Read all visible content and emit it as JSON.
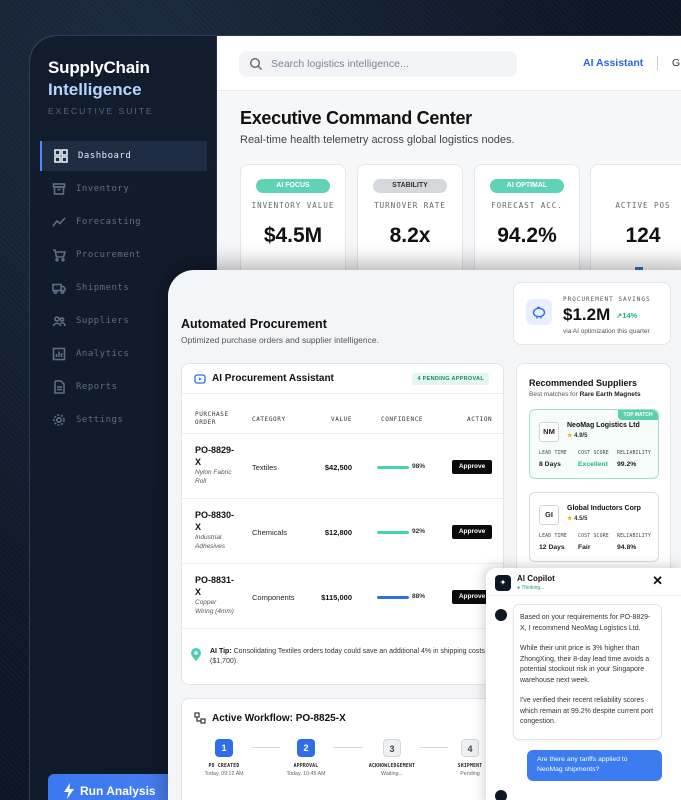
{
  "brand": {
    "line1": "SupplyChain",
    "line2": "Intelligence",
    "suite": "EXECUTIVE SUITE"
  },
  "sidebar": {
    "items": [
      {
        "label": "Dashboard",
        "icon": "grid-icon"
      },
      {
        "label": "Inventory",
        "icon": "box-icon"
      },
      {
        "label": "Forecasting",
        "icon": "trend-icon"
      },
      {
        "label": "Procurement",
        "icon": "cart-icon"
      },
      {
        "label": "Shipments",
        "icon": "truck-icon"
      },
      {
        "label": "Suppliers",
        "icon": "users-icon"
      },
      {
        "label": "Analytics",
        "icon": "chart-icon"
      },
      {
        "label": "Reports",
        "icon": "file-icon"
      },
      {
        "label": "Settings",
        "icon": "gear-icon"
      }
    ],
    "run_label": "Run Analysis"
  },
  "topbar": {
    "search_placeholder": "Search logistics intelligence...",
    "ai_assistant": "AI Assistant",
    "extra": "G"
  },
  "command": {
    "title": "Executive Command Center",
    "subtitle": "Real-time health telemetry across global logistics nodes.",
    "kpis": [
      {
        "pill": "AI FOCUS",
        "label": "INVENTORY VALUE",
        "value": "$4.5M",
        "pill_color": "#5fd3b4"
      },
      {
        "pill": "STABILITY",
        "label": "TURNOVER RATE",
        "value": "8.2x",
        "pill_color": "#d5d8dd"
      },
      {
        "pill": "AI OPTIMAL",
        "label": "FORECAST ACC.",
        "value": "94.2%",
        "pill_color": "#5fd3b4"
      },
      {
        "pill": "",
        "label": "ACTIVE POS",
        "value": "124",
        "pill_color": ""
      }
    ]
  },
  "procurement": {
    "title": "Automated Procurement",
    "subtitle": "Optimized purchase orders and supplier intelligence.",
    "savings": {
      "label": "PROCUREMENT SAVINGS",
      "value": "$1.2M",
      "delta": "↗14%",
      "note": "via AI optimization this quarter"
    },
    "assistant": {
      "title": "AI Procurement Assistant",
      "pending": "4 PENDING APPROVAL",
      "headers": {
        "po": "PURCHASE ORDER",
        "category": "CATEGORY",
        "value": "VALUE",
        "confidence": "CONFIDENCE",
        "action": "ACTION"
      },
      "rows": [
        {
          "po": "PO-8829-X",
          "desc": "Nylon Fabric Roll",
          "category": "Textiles",
          "value": "$42,500",
          "confidence": 98,
          "confidence_label": "98%",
          "bar_color": "#47d1b0",
          "action": "Approve"
        },
        {
          "po": "PO-8830-X",
          "desc": "Industrial Adhesives",
          "category": "Chemicals",
          "value": "$12,800",
          "confidence": 92,
          "confidence_label": "92%",
          "bar_color": "#47d1b0",
          "action": "Approve"
        },
        {
          "po": "PO-8831-X",
          "desc": "Copper Wiring (4mm)",
          "category": "Components",
          "value": "$115,000",
          "confidence": 88,
          "confidence_label": "88%",
          "bar_color": "#2f6ee6",
          "action": "Approve"
        }
      ],
      "tip_label": "AI Tip:",
      "tip": " Consolidating Textiles orders today could save an additional 4% in shipping costs ($1,700)."
    },
    "workflow": {
      "title": "Active Workflow: PO-8825-X",
      "steps": [
        {
          "num": "1",
          "label": "PO CREATED",
          "status": "Today, 09:12 AM",
          "done": true
        },
        {
          "num": "2",
          "label": "APPROVAL",
          "status": "Today, 10:45 AM",
          "done": true
        },
        {
          "num": "3",
          "label": "ACKNOWLEDGEMENT",
          "status": "Waiting...",
          "done": false
        },
        {
          "num": "4",
          "label": "SHIPMENT",
          "status": "Pending",
          "done": false
        }
      ]
    },
    "suppliers": {
      "title": "Recommended Suppliers",
      "subtitle_prefix": "Best matches for ",
      "subtitle_item": "Rare Earth Magnets",
      "items": [
        {
          "badge": "TOP MATCH",
          "logo": "NM",
          "name": "NeoMag Logistics Ltd",
          "rating": "4.9/5",
          "lead_label": "LEAD TIME",
          "lead": "8 Days",
          "cost_label": "COST SCORE",
          "cost": "Excellent",
          "rel_label": "RELIABILITY",
          "rel": "99.2%"
        },
        {
          "badge": "",
          "logo": "GI",
          "name": "Global Inductors Corp",
          "rating": "4.5/5",
          "lead_label": "LEAD TIME",
          "lead": "12 Days",
          "cost_label": "COST SCORE",
          "cost": "Fair",
          "rel_label": "RELIABILITY",
          "rel": "94.8%"
        }
      ]
    }
  },
  "copilot": {
    "title": "AI Copilot",
    "status": "● Thinking...",
    "close": "✕",
    "message": [
      "Based on your requirements for PO-8829-X, I recommend NeoMag Logistics Ltd.",
      "While their unit price is 3% higher than ZhongXing, their 8-day lead time avoids a potential stockout risk in your Singapore warehouse next week.",
      "I've verified their recent reliability scores which remain at 99.2% despite current port congestion."
    ],
    "user_message": "Are there any tariffs applied to NeoMag shipments?"
  }
}
